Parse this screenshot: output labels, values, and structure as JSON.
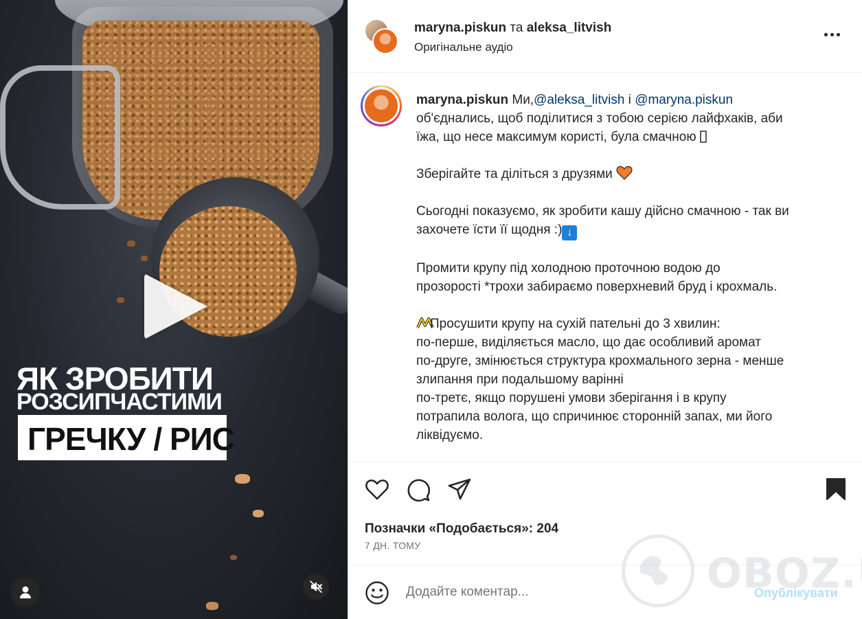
{
  "media": {
    "overlay_line1": "ЯК ЗРОБИТИ",
    "overlay_line2": "РОЗСИПЧАСТИМИ",
    "overlay_line3": "ГРЕЧКУ / РИС"
  },
  "header": {
    "user1": "maryna.piskun",
    "joiner": "та",
    "user2": "aleksa_litvish",
    "audio": "Оригінальне аудіо"
  },
  "caption": {
    "author": "maryna.piskun",
    "intro": " Ми,",
    "mention1": "@aleksa_litvish",
    "and": " і ",
    "mention2": "@maryna.piskun",
    "line1": "об'єднались, щоб поділитися з тобою серією лайфхаків, аби",
    "line2": "їжа, що несе максимум користі, була смачною",
    "save_share": "Зберігайте та діліться з друзями",
    "today1": "Сьогодні показуємо, як зробити кашу дійсно смачною - так ви",
    "today2": "захочете їсти її щодня :)",
    "arrow": "↓",
    "rinse1": "Промити крупу під холодною проточною водою до",
    "rinse2": "прозорості *трохи забираємо поверхневий бруд і крохмаль.",
    "dry": "Просушити крупу на сухій пательні до 3 хвилин:",
    "first": "по-перше, виділяється масло, що дає особливий аромат",
    "second1": "по-друге, змінюється структура крохмального зерна - менше",
    "second2": "злипання при подальшому варінні",
    "third1": "по-третє, якщо порушені умови зберігання і в крупу",
    "third2": "потрапила волога, що спричинює сторонній запах, ми його",
    "third3": "ліквідуємо."
  },
  "actions": {
    "likes": "Позначки «Подобається»: 204",
    "time": "7 ДН. ТОМУ"
  },
  "comment": {
    "placeholder": "Додайте коментар...",
    "publish": "Опублікувати"
  },
  "watermark": "OBOZ.UA",
  "colors": {
    "mention": "#00376b",
    "heart_emoji": "#f47b2a",
    "publish_disabled": "#b2dffc"
  }
}
